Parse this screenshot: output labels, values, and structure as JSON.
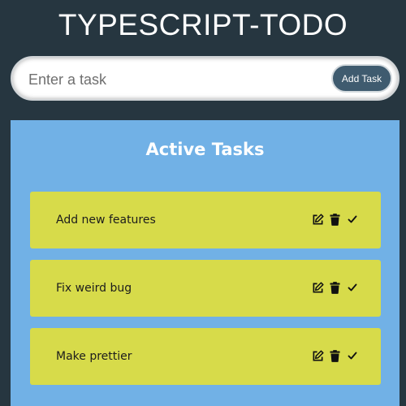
{
  "app": {
    "title": "TYPESCRIPT-TODO"
  },
  "input": {
    "placeholder": "Enter a task",
    "value": "",
    "add_button_label": "Add Task"
  },
  "active": {
    "heading": "Active Tasks",
    "tasks": [
      {
        "text": "Add new features"
      },
      {
        "text": "Fix weird bug"
      },
      {
        "text": "Make prettier"
      }
    ]
  },
  "icons": {
    "edit": "edit-icon",
    "delete": "trash-icon",
    "complete": "checkmark-icon"
  },
  "colors": {
    "background": "#263640",
    "panel": "#71b1e6",
    "task_card": "#d7db4a",
    "add_button": "#3f5b6f"
  }
}
